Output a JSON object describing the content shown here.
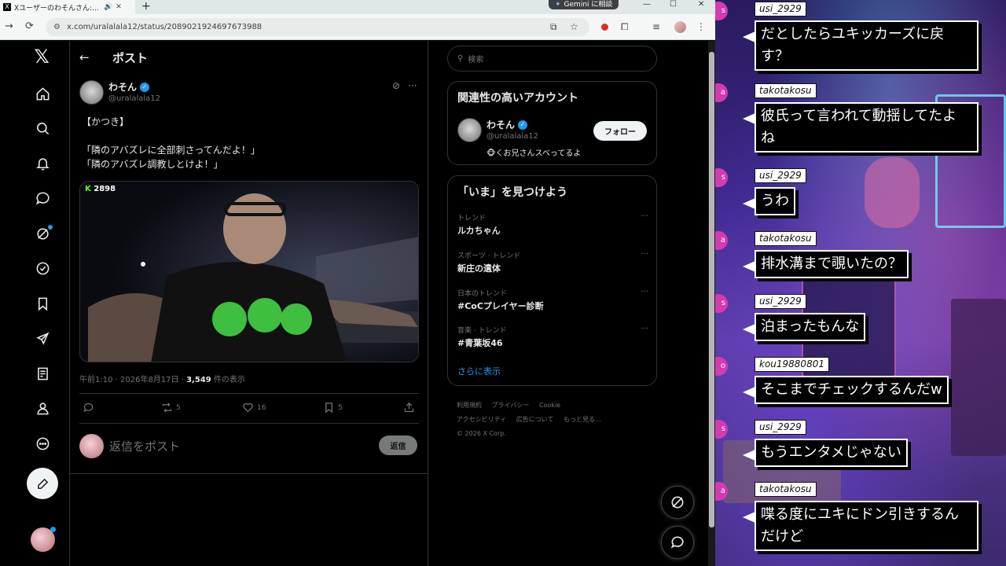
{
  "browser": {
    "tab_title": "Xユーザーのわそんさん:「かつき」",
    "new_tab": "+",
    "gemini_label": "Gemini に相談",
    "url": "x.com/uralalala12/status/2089021924697673988",
    "window_controls": [
      "—",
      "☐",
      "✕"
    ]
  },
  "post_page": {
    "header_title": "ポスト",
    "author": {
      "name": "わそん",
      "handle": "@uralalala12"
    },
    "text": "【かつき】\n\n「隣のアバズレに全部刺さってんだよ！」\n「隣のアバズレ調教しとけよ！」",
    "media_viewer_count": "2898",
    "timestamp": "午前1:10 · 2026年8月17日 · ",
    "views": "3,549",
    "views_suffix": " 件の表示",
    "stats": {
      "reposts": "5",
      "likes": "16",
      "bookmarks": "5"
    },
    "reply_placeholder": "返信をポスト",
    "reply_button": "返信"
  },
  "sidebar": {
    "search_placeholder": "検索",
    "relevant": {
      "title": "関連性の高いアカウント",
      "name": "わそん",
      "handle": "@uralalala12",
      "bio": "🐵くお兄さんスベってるよ",
      "follow_label": "フォロー"
    },
    "trends": {
      "title": "「いま」を見つけよう",
      "items": [
        {
          "category": "トレンド",
          "name": "ルカちゃん"
        },
        {
          "category": "スポーツ · トレンド",
          "name": "新庄の遺体"
        },
        {
          "category": "日本のトレンド",
          "name": "#CoCプレイヤー診断"
        },
        {
          "category": "音楽 · トレンド",
          "name": "#青葉坂46"
        }
      ],
      "show_more": "さらに表示"
    },
    "footer": [
      "利用規約",
      "プライバシー",
      "Cookie",
      "アクセシビリティ",
      "広告について",
      "もっと見る…",
      "© 2026 X Corp."
    ]
  },
  "chat": [
    {
      "user": "usi_2929",
      "text": "だとしたらユキッカーズに戻\nす？",
      "dot": "s"
    },
    {
      "user": "takotakosu",
      "text": "彼氏って言われて動揺してたよ\nね",
      "dot": "a"
    },
    {
      "user": "usi_2929",
      "text": "うわ",
      "dot": "s"
    },
    {
      "user": "takotakosu",
      "text": "排水溝まで覗いたの？",
      "dot": "a"
    },
    {
      "user": "usi_2929",
      "text": "泊まったもんな",
      "dot": "s"
    },
    {
      "user": "kou19880801",
      "text": "そこまでチェックするんだw",
      "dot": "o"
    },
    {
      "user": "usi_2929",
      "text": "もうエンタメじゃない",
      "dot": "s"
    },
    {
      "user": "takotakosu",
      "text": "喋る度にユキにドン引きするん\nだけど",
      "dot": "a"
    }
  ],
  "colors": {
    "x_blue": "#1d9bf0",
    "kick_green": "#53fc18",
    "chat_dot": "#d33bb0"
  }
}
